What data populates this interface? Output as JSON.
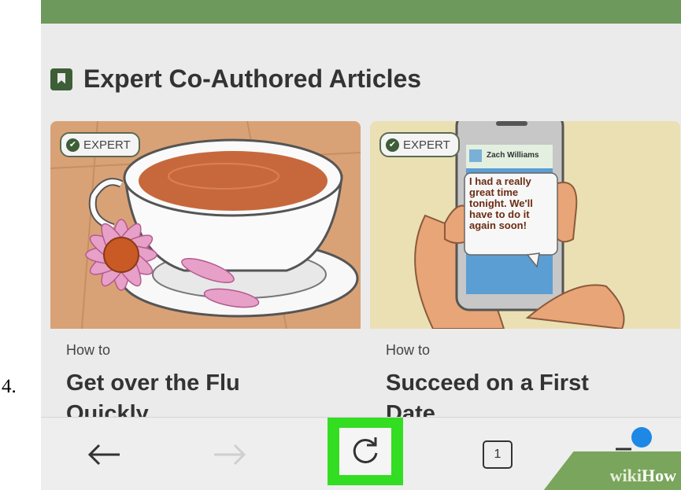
{
  "step": {
    "number": "4."
  },
  "section": {
    "title": "Expert Co-Authored Articles",
    "icon": "bookmark-icon"
  },
  "cards": [
    {
      "badge": "EXPERT",
      "prefix": "How to",
      "title_line1": "Get over the Flu",
      "title_line2": "Quickly",
      "image": "tea-cup-with-flower"
    },
    {
      "badge": "EXPERT",
      "prefix": "How to",
      "title_line1": "Succeed on a First",
      "title_line2": "Date",
      "image": "phone-text-message",
      "phone": {
        "contact": "Zach Williams",
        "message": [
          "I had a really",
          "great time",
          "tonight. We'll",
          "have to do it",
          "again soon!"
        ]
      }
    }
  ],
  "toolbar": {
    "back_icon": "back-arrow-icon",
    "forward_icon": "forward-arrow-icon",
    "reload_icon": "reload-icon",
    "tab_count": "1",
    "menu_icon": "menu-icon",
    "highlight_color": "#33dd22"
  },
  "watermark": {
    "wiki": "wiki",
    "how": "How"
  },
  "colors": {
    "accent_green": "#6d9a5c",
    "dark_green": "#3d5e37",
    "notification_blue": "#1e88e5"
  }
}
